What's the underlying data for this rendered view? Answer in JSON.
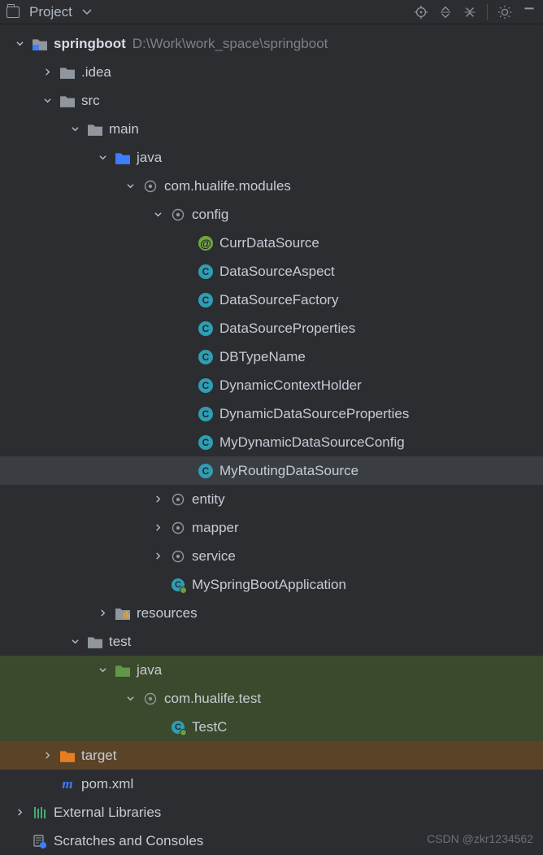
{
  "toolbar": {
    "title": "Project"
  },
  "tree": {
    "root": {
      "name": "springboot",
      "path": "D:\\Work\\work_space\\springboot"
    },
    "idea_folder": ".idea",
    "src": "src",
    "main": "main",
    "java_main": "java",
    "pkg_modules": "com.hualife.modules",
    "config": "config",
    "files": {
      "curr": "CurrDataSource",
      "aspect": "DataSourceAspect",
      "factory": "DataSourceFactory",
      "props": "DataSourceProperties",
      "dbtype": "DBTypeName",
      "dynctx": "DynamicContextHolder",
      "dynprops": "DynamicDataSourceProperties",
      "mydyn": "MyDynamicDataSourceConfig",
      "myroute": "MyRoutingDataSource"
    },
    "entity": "entity",
    "mapper": "mapper",
    "service": "service",
    "app": "MySpringBootApplication",
    "resources": "resources",
    "test": "test",
    "java_test": "java",
    "pkg_test": "com.hualife.test",
    "testc": "TestC",
    "target": "target",
    "pom": "pom.xml",
    "ext_lib": "External Libraries",
    "scratches": "Scratches and Consoles"
  },
  "watermark": "CSDN @zkr1234562"
}
